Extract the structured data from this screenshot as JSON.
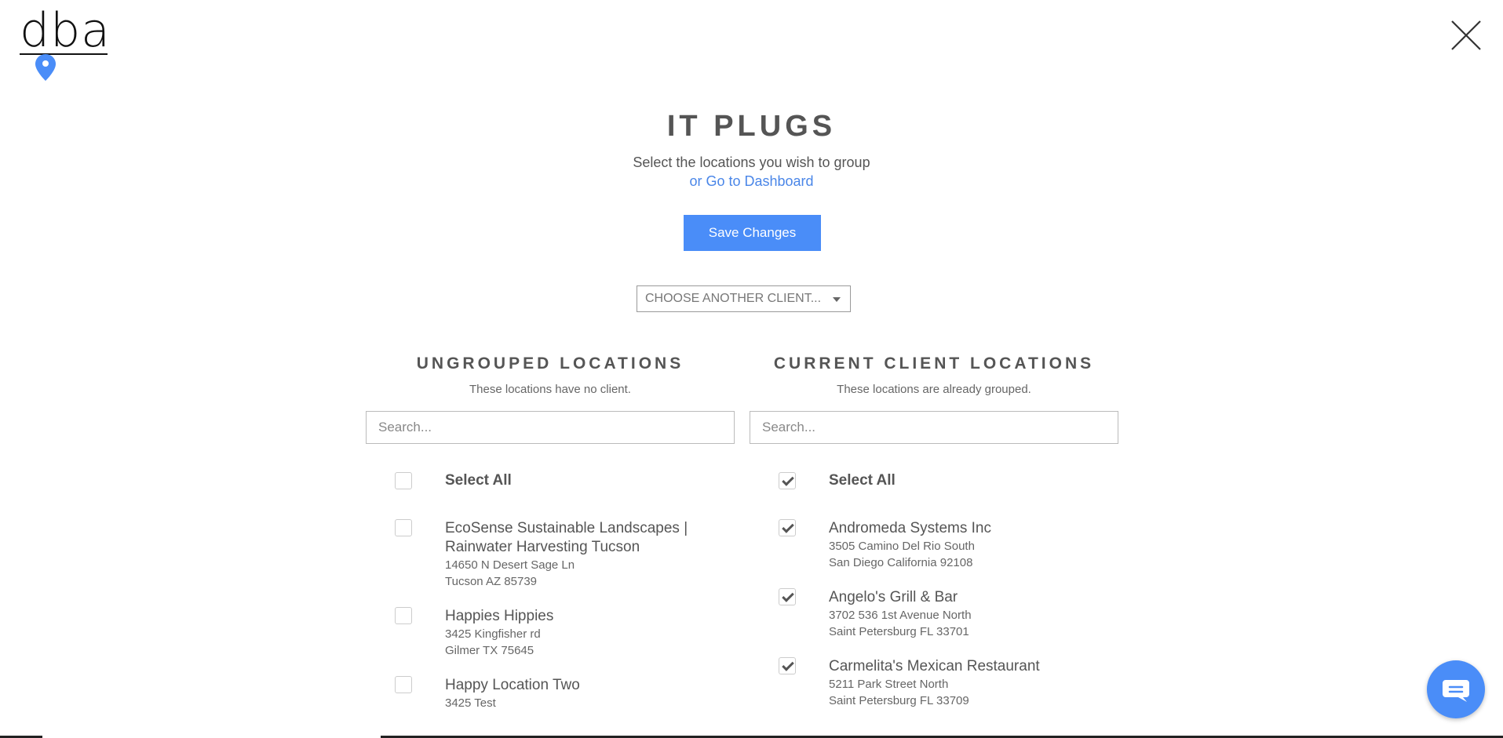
{
  "logo": {
    "text": "dba"
  },
  "header": {
    "title": "IT PLUGS",
    "subtitle": "Select the locations you wish to group",
    "dashboard_link": "or Go to Dashboard"
  },
  "save_button": "Save Changes",
  "client_select": {
    "selected": "CHOOSE ANOTHER CLIENT..."
  },
  "accent_color": "#4a8df8",
  "ungrouped": {
    "title": "UNGROUPED LOCATIONS",
    "description": "These locations have no client.",
    "search_placeholder": "Search...",
    "select_all": "Select All",
    "select_all_checked": false,
    "items": [
      {
        "name": "EcoSense Sustainable Landscapes | Rainwater Harvesting Tucson",
        "addr1": "14650 N Desert Sage Ln",
        "addr2": "Tucson AZ 85739",
        "checked": false
      },
      {
        "name": "Happies Hippies",
        "addr1": "3425 Kingfisher rd",
        "addr2": "Gilmer TX 75645",
        "checked": false
      },
      {
        "name": "Happy Location Two",
        "addr1": "3425 Test",
        "addr2": "",
        "checked": false
      }
    ]
  },
  "current": {
    "title": "CURRENT CLIENT LOCATIONS",
    "description": "These locations are already grouped.",
    "search_placeholder": "Search...",
    "select_all": "Select All",
    "select_all_checked": true,
    "items": [
      {
        "name": "Andromeda Systems Inc",
        "addr1": "3505 Camino Del Rio South",
        "addr2": "San Diego California 92108",
        "checked": true
      },
      {
        "name": "Angelo's Grill & Bar",
        "addr1": "3702 536 1st Avenue North",
        "addr2": "Saint Petersburg FL 33701",
        "checked": true
      },
      {
        "name": "Carmelita's Mexican Restaurant",
        "addr1": "5211 Park Street North",
        "addr2": "Saint Petersburg FL 33709",
        "checked": true
      }
    ]
  }
}
